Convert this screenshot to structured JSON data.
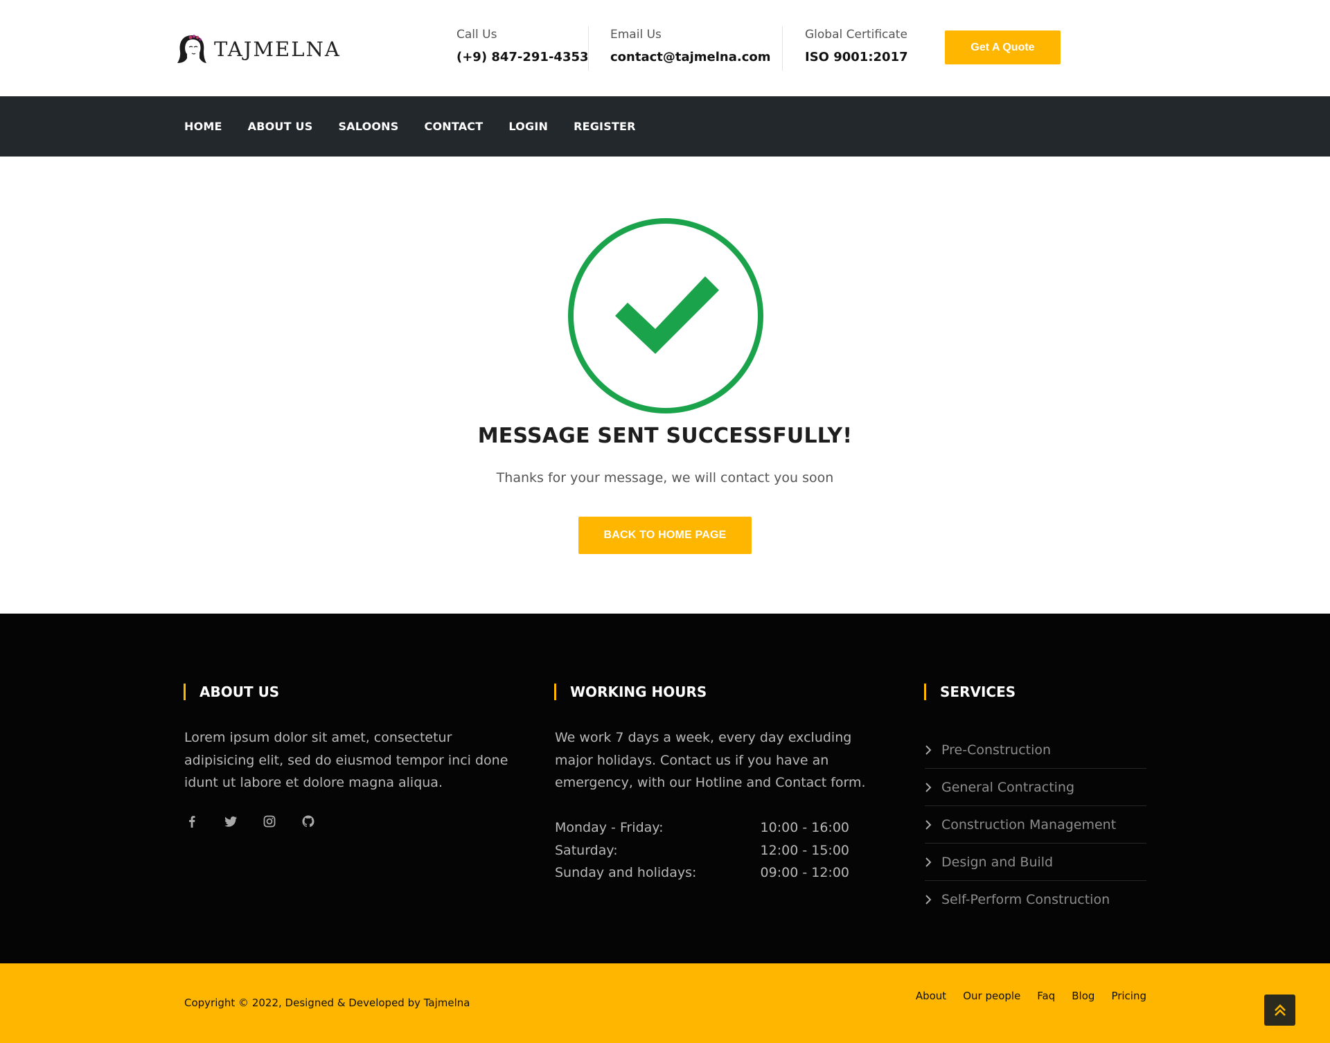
{
  "header": {
    "brand": "TAJMELNA",
    "call": {
      "label": "Call Us",
      "value": "(+9) 847-291-4353"
    },
    "email": {
      "label": "Email Us",
      "value": "contact@tajmelna.com"
    },
    "certificate": {
      "label": "Global Certificate",
      "value": "ISO 9001:2017"
    },
    "quote_button": "Get A Quote"
  },
  "nav": {
    "items": [
      {
        "label": "HOME"
      },
      {
        "label": "ABOUT US"
      },
      {
        "label": "SALOONS"
      },
      {
        "label": "CONTACT"
      },
      {
        "label": "LOGIN"
      },
      {
        "label": "REGISTER"
      }
    ]
  },
  "main": {
    "title": "MESSAGE SENT SUCCESSFULLY!",
    "text": "Thanks for your message, we will contact you soon",
    "button": "BACK TO HOME PAGE",
    "icon": "check-circle-icon"
  },
  "footer": {
    "about": {
      "title": "ABOUT US",
      "lines": [
        "Lorem ipsum dolor sit amet, consectetur",
        "adipisicing elit, sed do eiusmod tempor inci done",
        "idunt ut labore et dolore magna aliqua."
      ],
      "social": [
        "facebook-icon",
        "twitter-icon",
        "instagram-icon",
        "github-icon"
      ]
    },
    "hours": {
      "title": "WORKING HOURS",
      "lines": [
        "We work 7 days a week, every day excluding",
        "major holidays. Contact us if you have an",
        "emergency, with our Hotline and Contact form."
      ],
      "schedule": [
        {
          "day": "Monday - Friday:",
          "time": "10:00 - 16:00"
        },
        {
          "day": "Saturday:",
          "time": "12:00 - 15:00"
        },
        {
          "day": "Sunday and holidays:",
          "time": "09:00 - 12:00"
        }
      ]
    },
    "services": {
      "title": "SERVICES",
      "items": [
        "Pre-Construction",
        "General Contracting",
        "Construction Management",
        "Design and Build",
        "Self-Perform Construction"
      ]
    }
  },
  "bottom": {
    "copyright": "Copyright © 2022, Designed & Developed by Tajmelna",
    "links": [
      "About",
      "Our people",
      "Faq",
      "Blog",
      "Pricing"
    ]
  },
  "colors": {
    "accent": "#ffb600",
    "nav_bg": "#23282d",
    "footer_bg": "#050505",
    "success": "#1aa34a"
  }
}
